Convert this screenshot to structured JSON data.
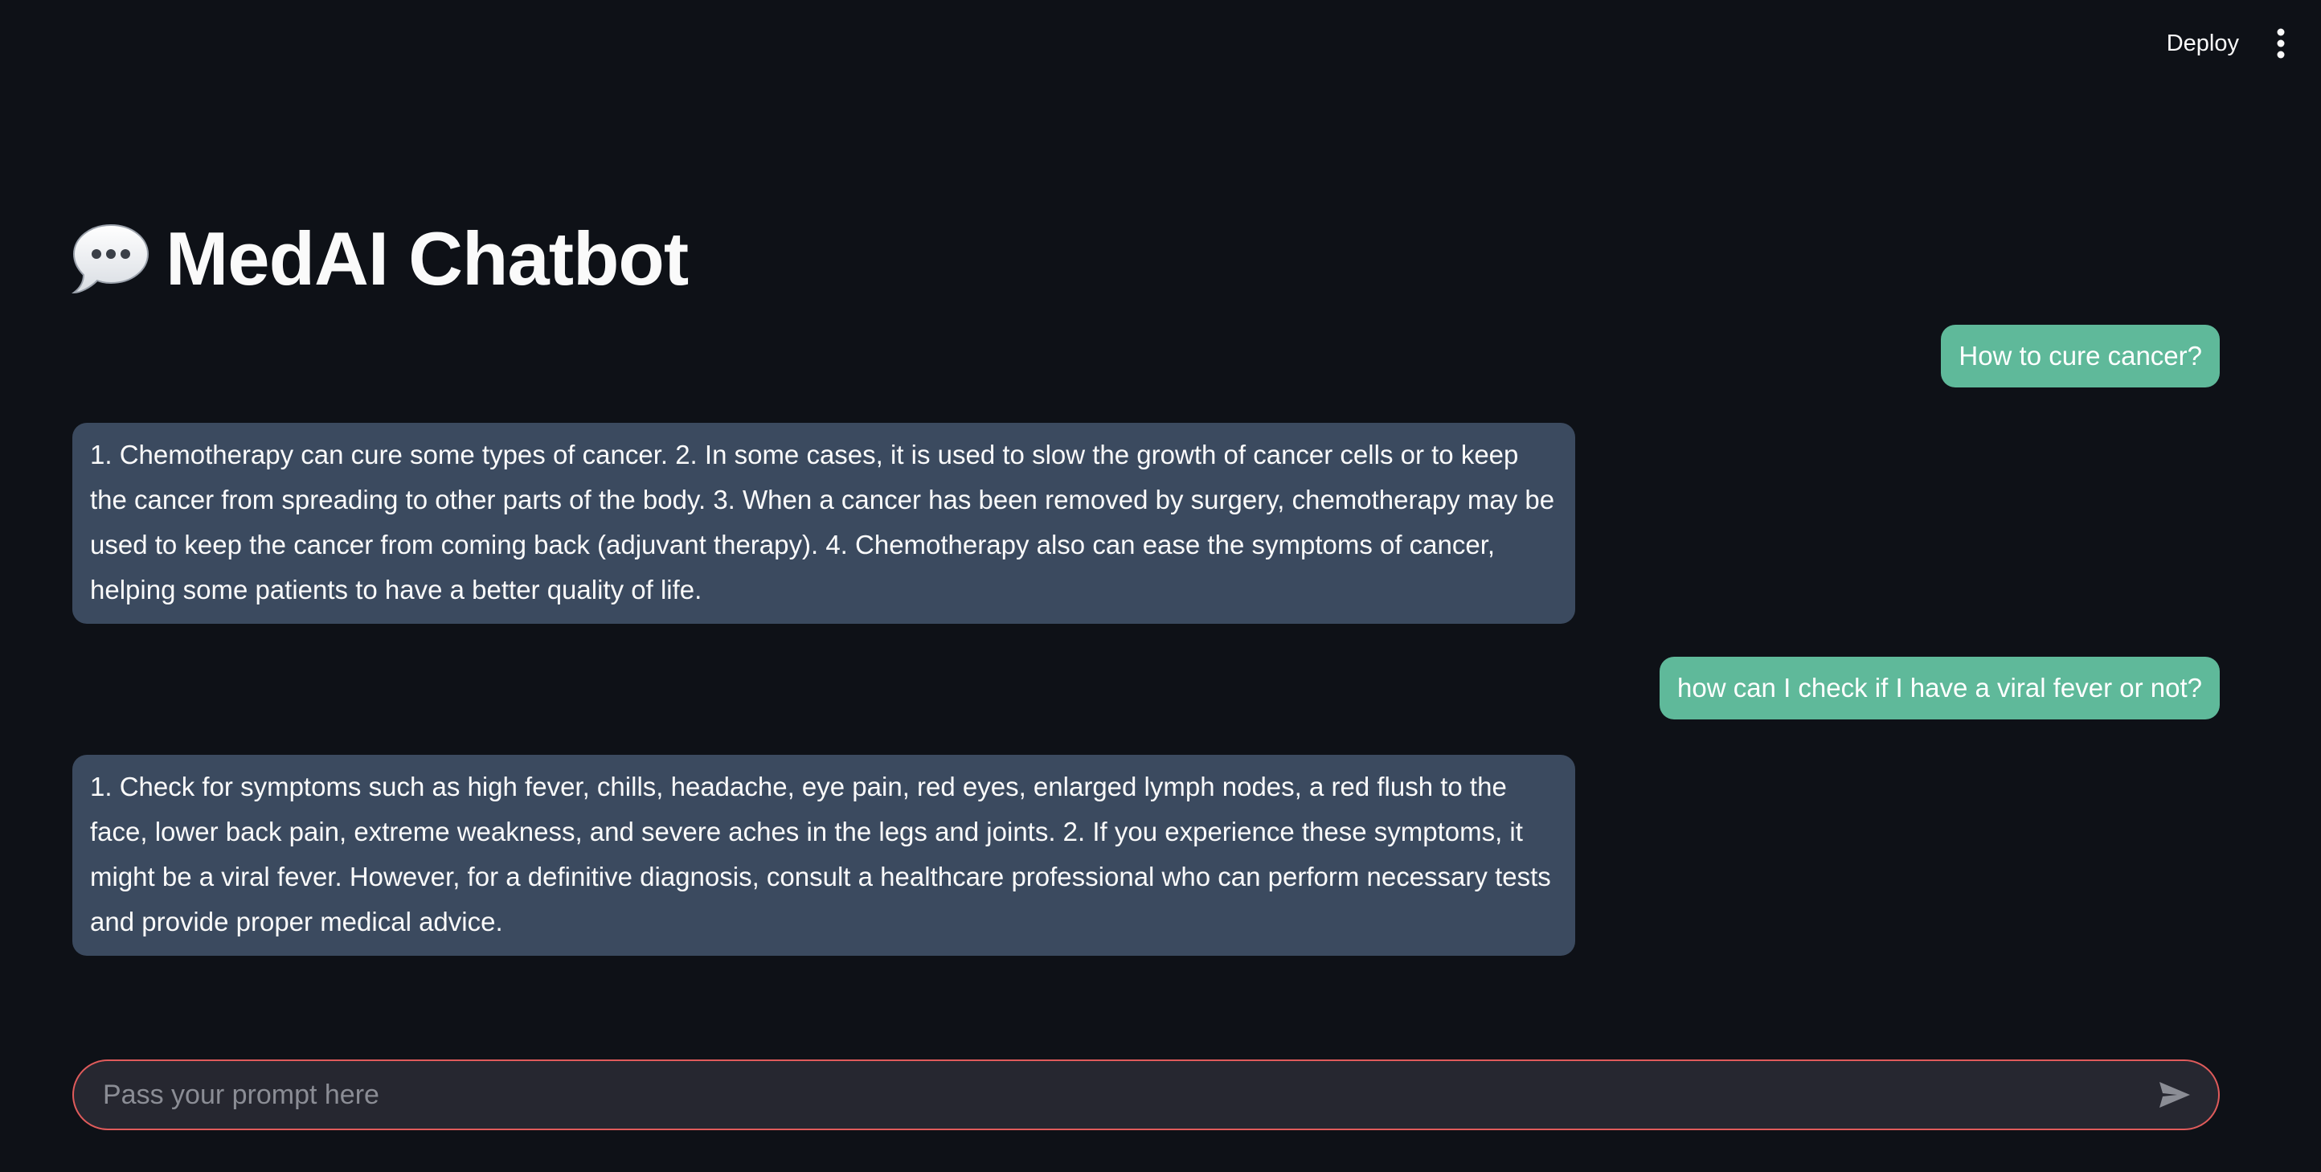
{
  "header": {
    "deploy_label": "Deploy",
    "menu_icon": "kebab-menu-icon"
  },
  "title": {
    "icon": "speech-bubble-icon",
    "text": "MedAI Chatbot"
  },
  "messages": [
    {
      "role": "user",
      "text": "How to cure cancer?"
    },
    {
      "role": "assistant",
      "text": "1. Chemotherapy can cure some types of cancer. 2. In some cases, it is used to slow the growth of cancer cells or to keep the cancer from spreading to other parts of the body. 3. When a cancer has been removed by surgery, chemotherapy may be used to keep the cancer from coming back (adjuvant therapy). 4. Chemotherapy also can ease the symptoms of cancer, helping some patients to have a better quality of life."
    },
    {
      "role": "user",
      "text": "how can I check if I have a viral fever or not?"
    },
    {
      "role": "assistant",
      "text": "1. Check for symptoms such as high fever, chills, headache, eye pain, red eyes, enlarged lymph nodes, a red flush to the face, lower back pain, extreme weakness, and severe aches in the legs and joints. 2. If you experience these symptoms, it might be a viral fever. However, for a definitive diagnosis, consult a healthcare professional who can perform necessary tests and provide proper medical advice."
    }
  ],
  "input": {
    "value": "",
    "placeholder": "Pass your prompt here",
    "send_icon": "send-arrow-icon"
  },
  "colors": {
    "background": "#0e1117",
    "user_bubble": "#5fb99a",
    "assistant_bubble": "#3b4a5f",
    "input_border": "#e05b5b"
  }
}
